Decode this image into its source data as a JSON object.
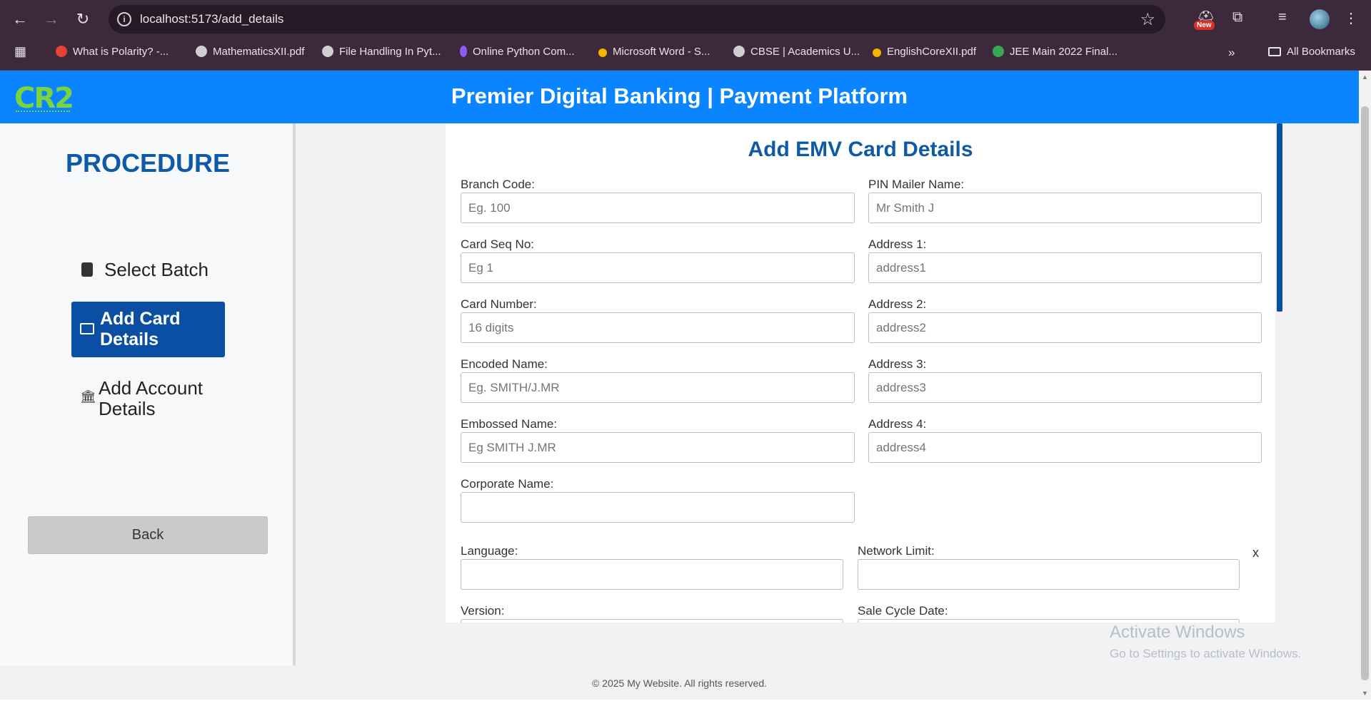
{
  "browser": {
    "url": "localhost:5173/add_details",
    "new_badge": "New",
    "bookmarks": [
      {
        "label": "What is Polarity? -...",
        "color": "#e94235"
      },
      {
        "label": "MathematicsXII.pdf",
        "color": "#cfcfcf"
      },
      {
        "label": "File Handling In Pyt...",
        "color": "#cfcfcf"
      },
      {
        "label": "Online Python Com...",
        "color": "#8b5cf6"
      },
      {
        "label": "Microsoft Word - S...",
        "color": "#f4b400"
      },
      {
        "label": "CBSE | Academics U...",
        "color": "#cfcfcf"
      },
      {
        "label": "EnglishCoreXII.pdf",
        "color": "#f4b400"
      },
      {
        "label": "JEE Main 2022 Final...",
        "color": "#34a853"
      }
    ],
    "all_bookmarks": "All Bookmarks"
  },
  "header": {
    "logo": "CR2",
    "title": "Premier Digital Banking | Payment Platform"
  },
  "sidebar": {
    "title": "PROCEDURE",
    "items": [
      {
        "label": "Select Batch"
      },
      {
        "label": "Add Card Details"
      },
      {
        "label": "Add Account Details"
      }
    ],
    "back": "Back"
  },
  "form": {
    "title": "Add EMV Card Details",
    "fields": {
      "branch_code": {
        "label": "Branch Code:",
        "placeholder": "Eg. 100"
      },
      "pin_mailer_name": {
        "label": "PIN Mailer Name:",
        "placeholder": "Mr Smith J"
      },
      "card_seq_no": {
        "label": "Card Seq No:",
        "placeholder": "Eg 1"
      },
      "address1": {
        "label": "Address 1:",
        "placeholder": "address1"
      },
      "card_number": {
        "label": "Card Number:",
        "placeholder": "16 digits"
      },
      "address2": {
        "label": "Address 2:",
        "placeholder": "address2"
      },
      "encoded_name": {
        "label": "Encoded Name:",
        "placeholder": "Eg. SMITH/J.MR"
      },
      "address3": {
        "label": "Address 3:",
        "placeholder": "address3"
      },
      "embossed_name": {
        "label": "Embossed Name:",
        "placeholder": "Eg SMITH J.MR"
      },
      "address4": {
        "label": "Address 4:",
        "placeholder": "address4"
      },
      "corporate_name": {
        "label": "Corporate Name:",
        "placeholder": ""
      },
      "language": {
        "label": "Language:",
        "placeholder": ""
      },
      "network_limit": {
        "label": "Network Limit:",
        "placeholder": ""
      },
      "version": {
        "label": "Version:"
      },
      "sale_cycle_date": {
        "label": "Sale Cycle Date:"
      }
    },
    "close": "x"
  },
  "watermark": {
    "line1": "Activate Windows",
    "line2": "Go to Settings to activate Windows."
  },
  "footer": {
    "text": "© 2025 My Website. All rights reserved."
  }
}
